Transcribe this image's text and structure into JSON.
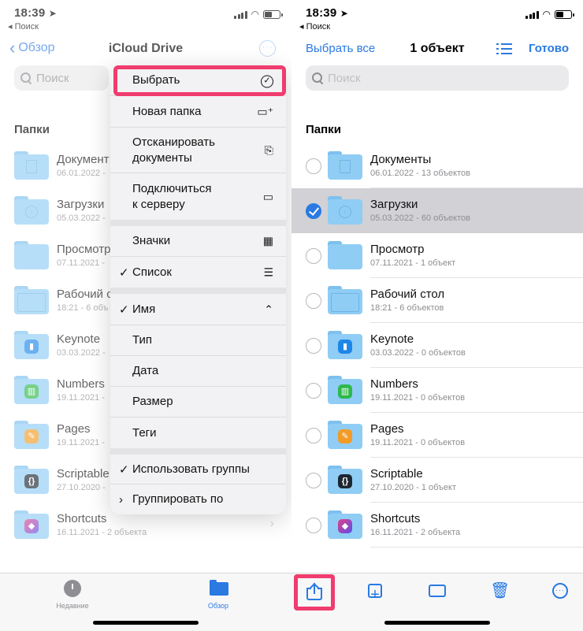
{
  "left": {
    "status": {
      "time": "18:39",
      "back": "◂ Поиск"
    },
    "nav": {
      "back_label": "Обзор",
      "title": "iCloud Drive",
      "more": "···"
    },
    "search": {
      "placeholder": "Поиск"
    },
    "section_title": "Папки",
    "rows": [
      {
        "name": "Документ",
        "meta": "06.01.2022 -"
      },
      {
        "name": "Загрузки",
        "meta": "05.03.2022 -"
      },
      {
        "name": "Просмотр",
        "meta": "07.11.2021 -"
      },
      {
        "name": "Рабочий с",
        "meta": "18:21 - 6 объ"
      },
      {
        "name": "Keynote",
        "meta": "03.03.2022 -"
      },
      {
        "name": "Numbers",
        "meta": "19.11.2021 -"
      },
      {
        "name": "Pages",
        "meta": "19.11.2021 -"
      },
      {
        "name": "Scriptable",
        "meta": "27.10.2020 -"
      },
      {
        "name": "Shortcuts",
        "meta": "16.11.2021 - 2 объекта"
      }
    ],
    "menu": {
      "select": "Выбрать",
      "new_folder": "Новая папка",
      "scan_1": "Отсканировать",
      "scan_2": "документы",
      "connect_1": "Подключиться",
      "connect_2": "к серверу",
      "icons": "Значки",
      "list": "Список",
      "name": "Имя",
      "type": "Тип",
      "date": "Дата",
      "size": "Размер",
      "tags": "Теги",
      "use_groups": "Использовать группы",
      "group_by": "Группировать по",
      "check": "✓"
    },
    "tabs": {
      "recent": "Недавние",
      "browse": "Обзор"
    }
  },
  "right": {
    "status": {
      "time": "18:39",
      "back": "◂ Поиск"
    },
    "nav": {
      "select_all": "Выбрать все",
      "title": "1 объект",
      "done": "Готово"
    },
    "search": {
      "placeholder": "Поиск"
    },
    "section_title": "Папки",
    "rows": [
      {
        "name": "Документы",
        "meta": "06.01.2022 - 13 объектов"
      },
      {
        "name": "Загрузки",
        "meta": "05.03.2022 - 60 объектов"
      },
      {
        "name": "Просмотр",
        "meta": "07.11.2021 - 1 объект"
      },
      {
        "name": "Рабочий стол",
        "meta": "18:21 - 6 объектов"
      },
      {
        "name": "Keynote",
        "meta": "03.03.2022 - 0 объектов"
      },
      {
        "name": "Numbers",
        "meta": "19.11.2021 - 0 объектов"
      },
      {
        "name": "Pages",
        "meta": "19.11.2021 - 0 объектов"
      },
      {
        "name": "Scriptable",
        "meta": "27.10.2020 - 1 объект"
      },
      {
        "name": "Shortcuts",
        "meta": "16.11.2021 - 2 объекта"
      }
    ],
    "selected_row": "Загрузки"
  },
  "colors": {
    "accent": "#2a7ae2",
    "highlight": "#f03c6e",
    "folder": "#8fcdf5"
  }
}
